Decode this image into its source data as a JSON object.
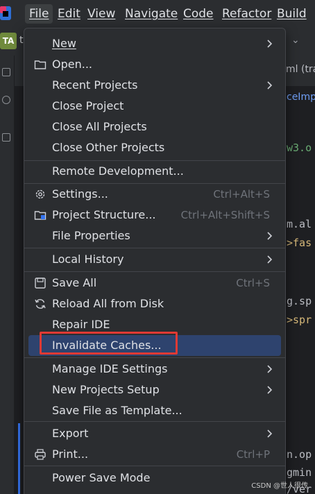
{
  "menubar": {
    "items": [
      {
        "label": "File",
        "active": true
      },
      {
        "label": "Edit"
      },
      {
        "label": "View"
      },
      {
        "label": "Navigate"
      },
      {
        "label": "Code"
      },
      {
        "label": "Refactor"
      },
      {
        "label": "Build"
      }
    ]
  },
  "project_badge": "TA",
  "project_name_fragment": "t",
  "editor_fragments": {
    "tab_right": "ml (tra",
    "tab2_right": "ceImp",
    "line_w3": "w3.o",
    "line_m_al": "m.al",
    "line_fas": ">fas",
    "line_g_sp": "g.sp",
    "line_spr": ">spr",
    "line_n_op": "n.op",
    "line_gmin": "gmin",
    "line_ver": "/ver"
  },
  "file_menu": {
    "items": [
      {
        "label": "New",
        "submenu": true
      },
      {
        "label": "Open...",
        "icon": "folder-icon"
      },
      {
        "label": "Recent Projects",
        "submenu": true
      },
      {
        "label": "Close Project"
      },
      {
        "label": "Close All Projects"
      },
      {
        "label": "Close Other Projects"
      },
      {
        "label": "Remote Development..."
      },
      {
        "label": "Settings...",
        "shortcut": "Ctrl+Alt+S",
        "icon": "gear-icon"
      },
      {
        "label": "Project Structure...",
        "shortcut": "Ctrl+Alt+Shift+S",
        "icon": "project-structure-icon"
      },
      {
        "label": "File Properties",
        "submenu": true
      },
      {
        "label": "Local History",
        "submenu": true
      },
      {
        "label": "Save All",
        "shortcut": "Ctrl+S",
        "icon": "save-icon"
      },
      {
        "label": "Reload All from Disk",
        "icon": "reload-icon"
      },
      {
        "label": "Repair IDE"
      },
      {
        "label": "Invalidate Caches...",
        "highlighted": true
      },
      {
        "label": "Manage IDE Settings",
        "submenu": true
      },
      {
        "label": "New Projects Setup",
        "submenu": true
      },
      {
        "label": "Save File as Template..."
      },
      {
        "label": "Export",
        "submenu": true
      },
      {
        "label": "Print...",
        "shortcut": "Ctrl+P",
        "icon": "print-icon"
      },
      {
        "label": "Power Save Mode"
      }
    ]
  },
  "watermark": "CSDN @世人很传",
  "colors": {
    "menu_bg": "#2b2d30",
    "highlight": "#2e436e",
    "annotation_red": "#e03a34",
    "text": "#dfe1e5",
    "shortcut": "#6f737a"
  }
}
